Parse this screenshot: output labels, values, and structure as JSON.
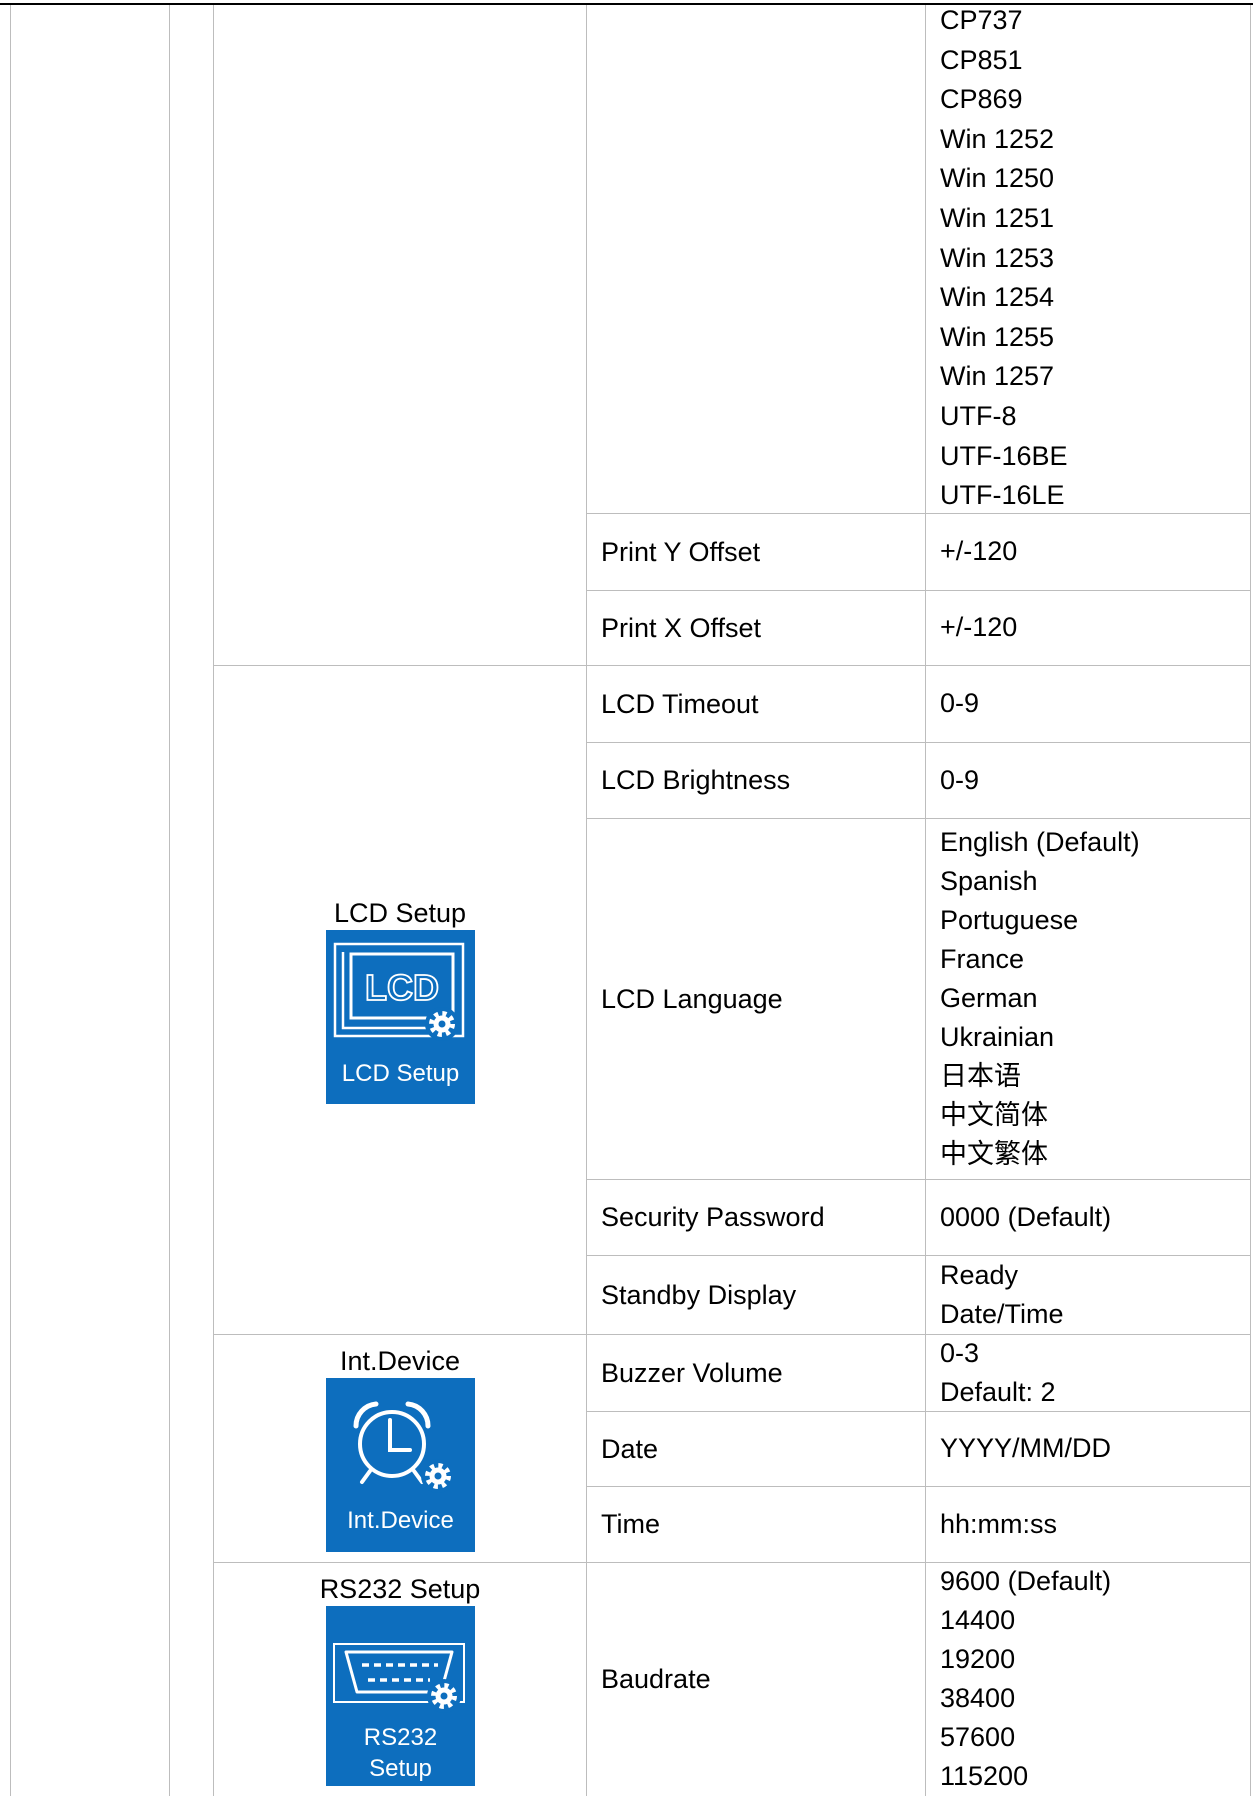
{
  "colors": {
    "icon_background": "#0d6ebe",
    "icon_foreground": "#ffffff",
    "table_border": "#bdbdbd",
    "top_rule": "#000000",
    "text": "#000000"
  },
  "continued_row": {
    "values": [
      "CP737",
      "CP851",
      "CP869",
      "Win 1252",
      "Win 1250",
      "Win 1251",
      "Win 1253",
      "Win 1254",
      "Win 1255",
      "Win 1257",
      "UTF-8",
      "UTF-16BE",
      "UTF-16LE"
    ]
  },
  "print_rows": [
    {
      "parameter": "Print Y Offset",
      "values": [
        "+/-120"
      ]
    },
    {
      "parameter": "Print X Offset",
      "values": [
        "+/-120"
      ]
    }
  ],
  "lcd_setup": {
    "label": "LCD Setup",
    "icon": {
      "name": "lcd-setup-icon",
      "badge": "gear-icon",
      "screen_text": "LCD",
      "caption": [
        "LCD Setup"
      ]
    },
    "rows": [
      {
        "parameter": "LCD Timeout",
        "values": [
          "0-9"
        ]
      },
      {
        "parameter": "LCD Brightness",
        "values": [
          "0-9"
        ]
      },
      {
        "parameter": "LCD Language",
        "values": [
          "English (Default)",
          "Spanish",
          "Portuguese",
          "France",
          "German",
          "Ukrainian",
          "日本语",
          "中文简体",
          "中文繁体"
        ]
      },
      {
        "parameter": "Security Password",
        "values": [
          "0000 (Default)"
        ]
      },
      {
        "parameter": "Standby Display",
        "values": [
          "Ready",
          "Date/Time"
        ]
      }
    ]
  },
  "int_device": {
    "label": "Int.Device",
    "icon": {
      "name": "alarm-clock-icon",
      "badge": "gear-icon",
      "caption": [
        "Int.Device"
      ]
    },
    "rows": [
      {
        "parameter": "Buzzer Volume",
        "values": [
          "0-3",
          "Default: 2"
        ]
      },
      {
        "parameter": "Date",
        "values": [
          "YYYY/MM/DD"
        ]
      },
      {
        "parameter": "Time",
        "values": [
          "hh:mm:ss"
        ]
      }
    ]
  },
  "rs232_setup": {
    "label": "RS232 Setup",
    "icon": {
      "name": "serial-port-icon",
      "badge": "gear-icon",
      "caption": [
        "RS232",
        "Setup"
      ]
    },
    "rows": [
      {
        "parameter": "Baudrate",
        "values": [
          "9600 (Default)",
          "14400",
          "19200",
          "38400",
          "57600",
          "115200"
        ]
      }
    ]
  }
}
